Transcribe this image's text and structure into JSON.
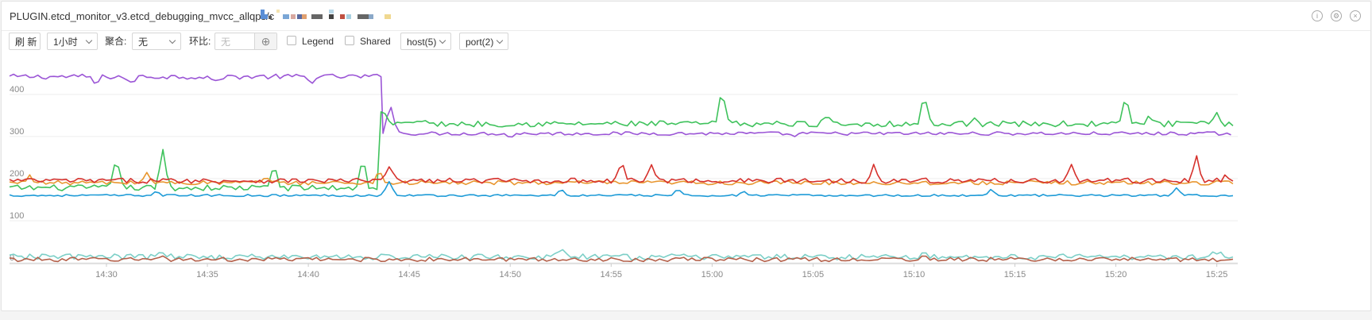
{
  "panel": {
    "title": "PLUGIN.etcd_monitor_v3.etcd_debugging_mvcc_allqps/c",
    "info_icon": "info-icon",
    "settings_icon": "gear-icon",
    "menu_icon": "close-icon"
  },
  "toolbar": {
    "refresh_label": "刷 新",
    "time_range": "1小时",
    "aggregate_label": "聚合:",
    "aggregate_value": "无",
    "compare_label": "环比:",
    "compare_placeholder": "无",
    "add_symbol": "⊕",
    "legend_label": "Legend",
    "shared_label": "Shared",
    "host_filter": "host(5)",
    "port_filter": "port(2)"
  },
  "colors": {
    "purple": "#9b55d6",
    "green": "#3fc25c",
    "red": "#d6312c",
    "orange": "#e8962f",
    "blue": "#1e9bd7",
    "teal": "#7ccfc7",
    "brown": "#b4604a"
  },
  "chart_data": {
    "type": "line",
    "title": "",
    "xlabel": "",
    "ylabel": "",
    "y_ticks": [
      "0",
      "100",
      "200",
      "300",
      "400"
    ],
    "ylim": [
      0,
      460
    ],
    "x_ticks": [
      "14:30",
      "14:35",
      "14:40",
      "14:45",
      "14:50",
      "14:55",
      "15:00",
      "15:05",
      "15:10",
      "15:15",
      "15:20",
      "15:25"
    ],
    "xlim_minutes": [
      -4.8,
      55.8
    ],
    "grid": "horizontal",
    "legend": "hidden",
    "series": [
      {
        "color": "#9b55d6",
        "segments": [
          {
            "from": -4.8,
            "to": 13.6,
            "base": 442,
            "jitter": 6,
            "spikes": [
              [
                -0.5,
                -20
              ],
              [
                1.2,
                -18
              ],
              [
                5.4,
                -15
              ],
              [
                10.1,
                -14
              ]
            ]
          },
          {
            "from": 13.7,
            "to": 55.8,
            "base": 307,
            "jitter": 4,
            "spikes": [
              [
                14.0,
                60
              ],
              [
                14.2,
                30
              ],
              [
                20.0,
                -10
              ],
              [
                34.0,
                -8
              ]
            ]
          }
        ]
      },
      {
        "color": "#3fc25c",
        "segments": [
          {
            "from": -4.8,
            "to": 13.5,
            "base": 178,
            "jitter": 7,
            "spikes": [
              [
                0.5,
                80
              ],
              [
                2.8,
                90
              ],
              [
                8.3,
                60
              ],
              [
                12.7,
                70
              ]
            ]
          },
          {
            "from": 13.6,
            "to": 55.8,
            "base": 330,
            "jitter": 7,
            "spikes": [
              [
                13.7,
                40
              ],
              [
                15.5,
                15
              ],
              [
                30.5,
                85
              ],
              [
                35.7,
                25
              ],
              [
                40.5,
                70
              ],
              [
                43.0,
                20
              ],
              [
                50.5,
                65
              ],
              [
                51.7,
                20
              ],
              [
                55.0,
                20
              ]
            ]
          }
        ]
      },
      {
        "color": "#e8962f",
        "segments": [
          {
            "from": -4.8,
            "to": 55.8,
            "base": 190,
            "jitter": 5,
            "spikes": [
              [
                -3.8,
                20
              ],
              [
                2.0,
                25
              ],
              [
                8.0,
                15
              ],
              [
                13.5,
                30
              ]
            ]
          }
        ]
      },
      {
        "color": "#d6312c",
        "segments": [
          {
            "from": -4.8,
            "to": 55.8,
            "base": 195,
            "jitter": 6,
            "spikes": [
              [
                14.0,
                35
              ],
              [
                25.5,
                50
              ],
              [
                27.0,
                40
              ],
              [
                38.0,
                40
              ],
              [
                47.8,
                35
              ],
              [
                54.0,
                55
              ],
              [
                55.5,
                15
              ]
            ]
          }
        ]
      },
      {
        "color": "#1e9bd7",
        "segments": [
          {
            "from": -4.8,
            "to": 55.8,
            "base": 160,
            "jitter": 2.5,
            "spikes": [
              [
                2.5,
                12
              ],
              [
                14.0,
                35
              ],
              [
                22.5,
                15
              ],
              [
                28.3,
                15
              ],
              [
                31.5,
                10
              ],
              [
                43.8,
                15
              ],
              [
                53.0,
                18
              ]
            ]
          }
        ]
      },
      {
        "color": "#7ccfc7",
        "segments": [
          {
            "from": -4.8,
            "to": 55.8,
            "base": 14,
            "jitter": 7,
            "spikes": [
              [
                -2.0,
                12
              ],
              [
                2.8,
                14
              ],
              [
                22.5,
                22
              ],
              [
                30.2,
                10
              ],
              [
                40.5,
                18
              ],
              [
                55.0,
                14
              ]
            ]
          }
        ]
      },
      {
        "color": "#b4604a",
        "segments": [
          {
            "from": -4.8,
            "to": 55.8,
            "base": 8,
            "jitter": 5,
            "spikes": [
              [
                2.8,
                10
              ],
              [
                40.5,
                12
              ]
            ]
          }
        ]
      }
    ]
  }
}
